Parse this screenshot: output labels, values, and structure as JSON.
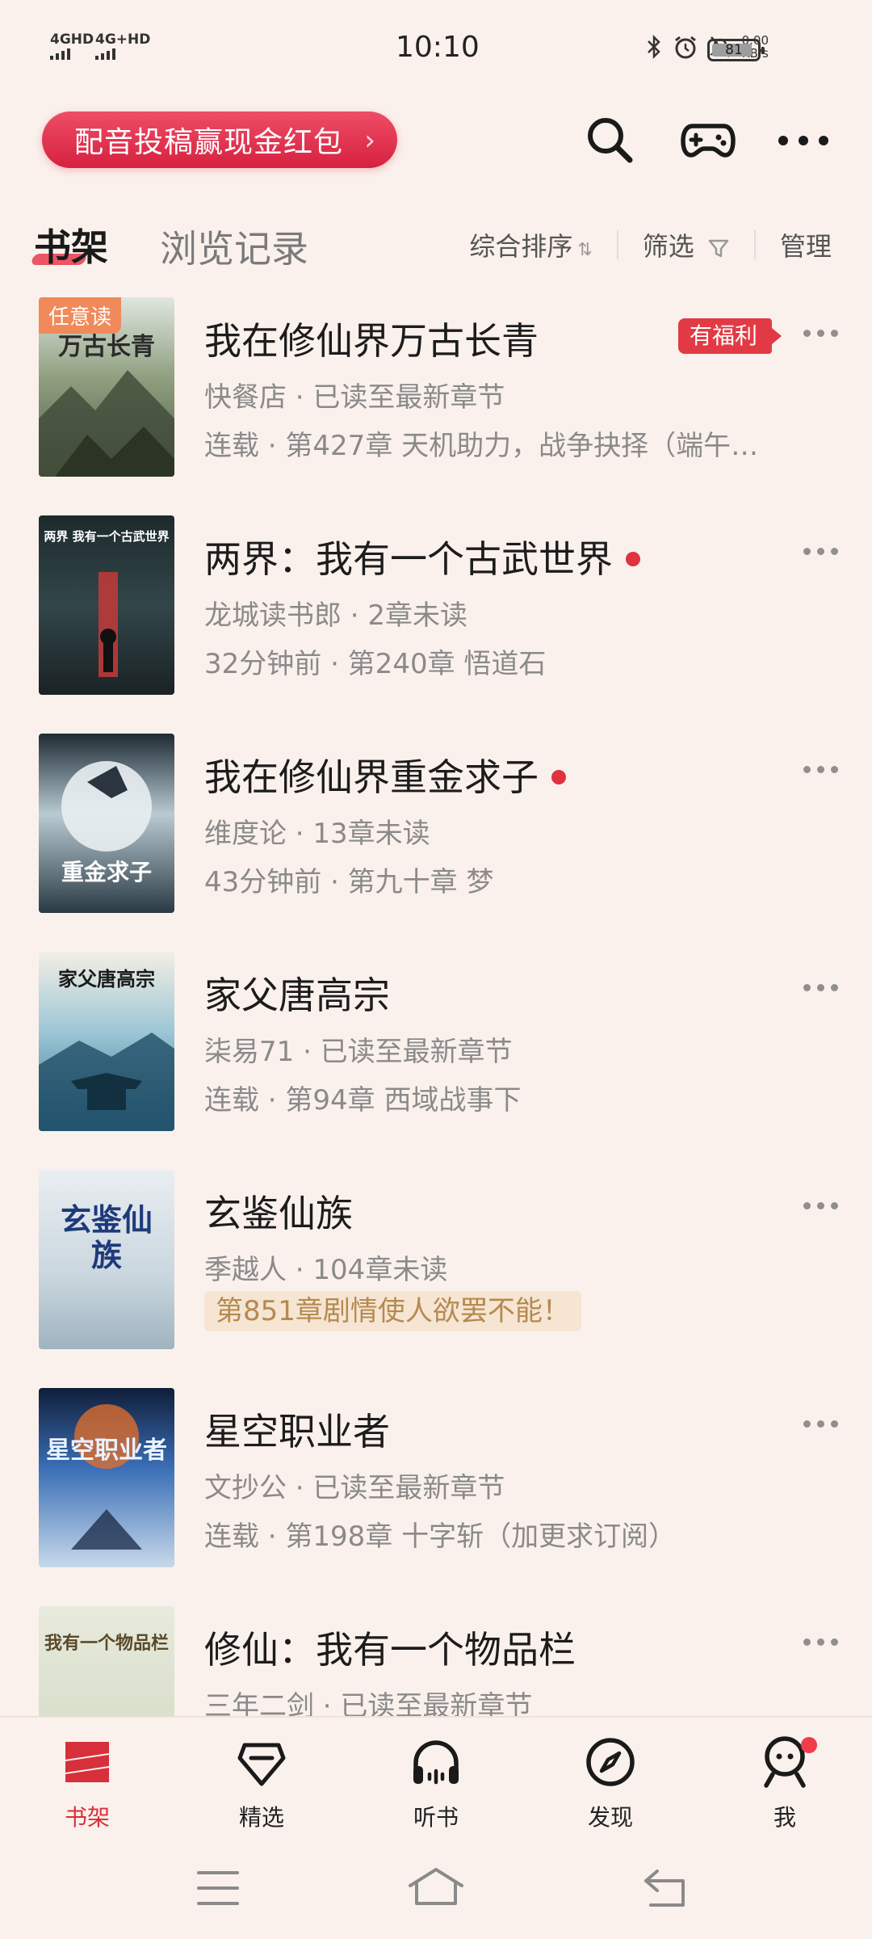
{
  "status_bar": {
    "net1": "4GHD",
    "net2": "4G+HD",
    "time": "10:10",
    "speed_value": "0.00",
    "speed_unit": "KB/s",
    "battery": "81"
  },
  "promo_banner": "配音投稿赢现金红包",
  "tabs": {
    "shelf": "书架",
    "history": "浏览记录"
  },
  "tools": {
    "sort": "综合排序",
    "filter": "筛选",
    "manage": "管理"
  },
  "books": [
    {
      "title": "我在修仙界万古长青",
      "line1": "快餐店 · 已读至最新章节",
      "line2": "连载 · 第427章 天机助力，战争抉择（端午…",
      "badge": "任意读",
      "tag": "有福利",
      "cover_text": "万古长青"
    },
    {
      "title": "两界：我有一个古武世界",
      "line1": "龙城读书郎 · 2章未读",
      "line2": "32分钟前 · 第240章 悟道石",
      "cover_text": "两界 我有一个古武世界"
    },
    {
      "title": "我在修仙界重金求子",
      "line1": "维度论 · 13章未读",
      "line2": "43分钟前 · 第九十章 梦",
      "cover_text": "重金求子"
    },
    {
      "title": "家父唐高宗",
      "line1": "柒易71 · 已读至最新章节",
      "line2": "连载 · 第94章 西域战事下",
      "cover_text": "家父唐高宗"
    },
    {
      "title": "玄鉴仙族",
      "line1": "季越人 · 104章未读",
      "promo": "第851章剧情使人欲罢不能！",
      "cover_text": "玄鉴仙族"
    },
    {
      "title": "星空职业者",
      "line1": "文抄公 · 已读至最新章节",
      "line2": "连载 · 第198章 十字斩（加更求订阅）",
      "cover_text": "星空职业者"
    },
    {
      "title": "修仙：我有一个物品栏",
      "line1": "三年二剑 · 已读至最新章节",
      "cover_text": "我有一个物品栏"
    }
  ],
  "nav": [
    {
      "label": "书架",
      "icon": "shelf-icon"
    },
    {
      "label": "精选",
      "icon": "diamond-icon"
    },
    {
      "label": "听书",
      "icon": "headphones-icon"
    },
    {
      "label": "发现",
      "icon": "compass-icon"
    },
    {
      "label": "我",
      "icon": "profile-icon"
    }
  ],
  "colors": {
    "accent": "#d72f3b",
    "background": "#fbf1ec"
  }
}
